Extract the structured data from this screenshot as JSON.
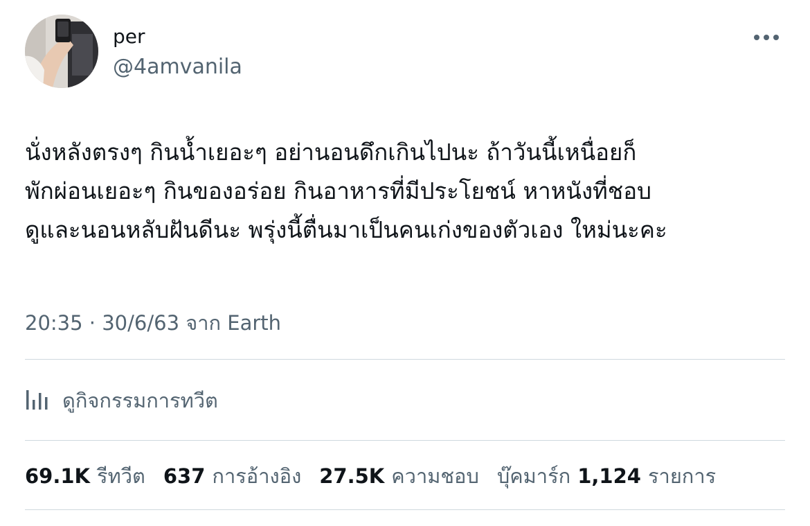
{
  "tweet": {
    "display_name": "per",
    "handle": "@4amvanila",
    "text_lines": [
      "นั่งหลังตรงๆ กินน้ำเยอะๆ อย่านอนดึกเกินไปนะ ถ้าวันนี้เหนื่อยก็",
      "พักผ่อนเยอะๆ กินของอร่อย กินอาหารที่มีประโยชน์ หาหนังที่ชอบ",
      "ดูและนอนหลับฝันดีนะ พรุ่งนี้ตื่นมาเป็นคนเก่งของตัวเอง ใหม่นะคะ"
    ],
    "timestamp": "20:35 · 30/6/63 จาก Earth",
    "analytics_label": "ดูกิจกรรมการทวีต",
    "stats": {
      "retweets": {
        "value": "69.1K",
        "label": "รีทวีต"
      },
      "quotes": {
        "value": "637",
        "label": "การอ้างอิง"
      },
      "likes": {
        "value": "27.5K",
        "label": "ความชอบ"
      },
      "bookmarks": {
        "prefix": "บุ๊คมาร์ก",
        "value": "1,124",
        "label": "รายการ"
      }
    }
  },
  "icons": {
    "more": "more-horizontal-icon",
    "analytics": "bar-chart-icon"
  },
  "colors": {
    "text_primary": "#0f1419",
    "text_secondary": "#536471",
    "divider": "#cfd9de",
    "background": "#ffffff"
  }
}
